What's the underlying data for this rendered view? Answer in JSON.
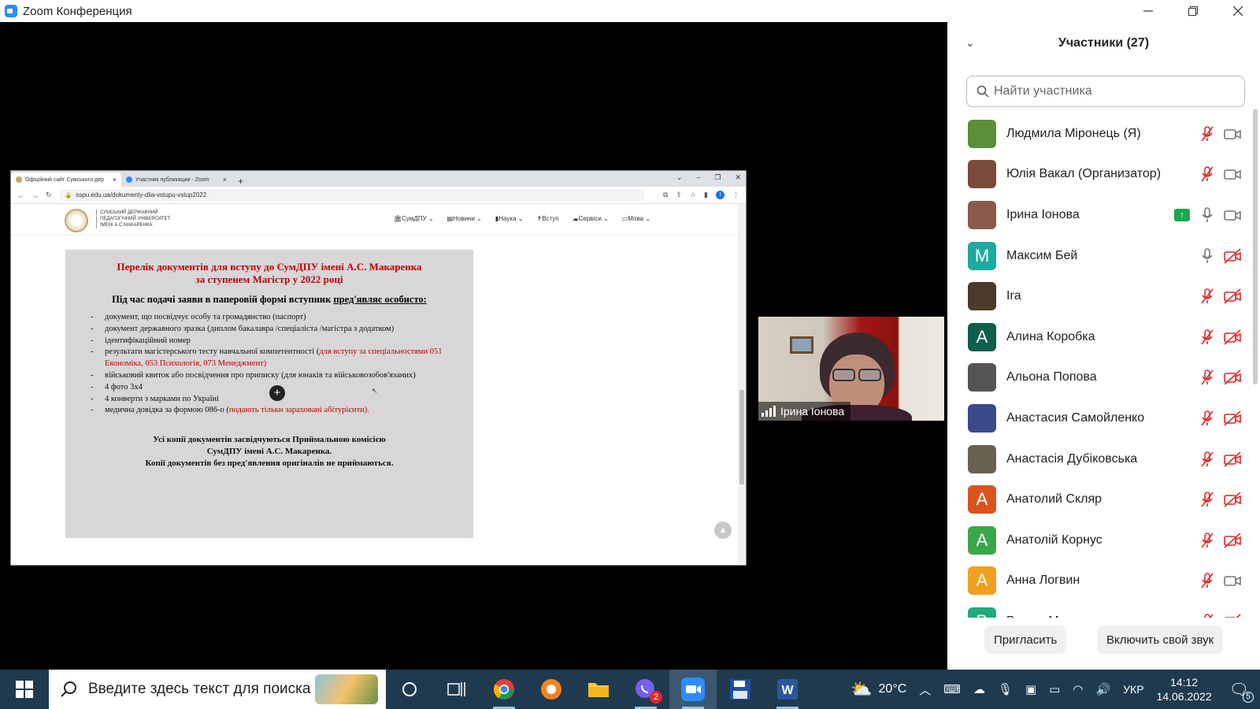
{
  "window": {
    "title": "Zoom Конференция"
  },
  "browser": {
    "tabs": [
      {
        "label": "Офіційний сайт Сумського дер"
      },
      {
        "label": "Участник публикации - Zoom"
      }
    ],
    "url": "sspu.edu.ua/dokumenty-dlia-vstupu-vstup2022",
    "site_name": "СУМСЬКИЙ ДЕРЖАВНИЙ ПЕДАГОГІЧНИЙ УНІВЕРСИТЕТ ІМЕНІ А.С.МАКАРЕНКА",
    "nav": [
      "СумДПУ",
      "Новини",
      "Наука",
      "Вступ",
      "Сервіси",
      "Мова"
    ],
    "doc": {
      "title_line1": "Перелік документів для вступу до СумДПУ імені А.С. Макаренка",
      "title_line2": "за ступенем Магістр у 2022 році",
      "subtitle_prefix": "Під час подачі заяви в паперовій формі вступник ",
      "subtitle_underlined": "пред'являє особисто:",
      "items": [
        {
          "text": "документ, що посвідчує особу та громадянство (паспорт)",
          "note": ""
        },
        {
          "text": "документ державного зразка (диплом бакалавра /спеціаліста /магістра з додатком)",
          "note": ""
        },
        {
          "text": "ідентифікаційний номер",
          "note": ""
        },
        {
          "text": "результати магістерського тесту навчальної компетентності (",
          "note": "для вступу за спеціальностями 051 Економіка, 053 Психологія, 073 Менеджмент",
          "suffix": ")"
        },
        {
          "text": "військовий квиток або посвідчення про приписку (для юнаків та військовозобов'язаних)",
          "note": ""
        },
        {
          "text": "4 фото 3х4",
          "note": ""
        },
        {
          "text": "4 конверти з марками по Україні",
          "note": ""
        },
        {
          "text": "медична довідка за формою 086-о (",
          "note": "подають тільки зараховані абітурієнти",
          "suffix": ")."
        }
      ],
      "footer_line1": "Усі копії документів засвідчуються Приймальною комісією",
      "footer_line2": "СумДПУ імені А.С. Макаренка.",
      "footer_line3": "Копії документів без пред'явлення оригіналів не приймаються."
    }
  },
  "video": {
    "name": "Ірина Іонова"
  },
  "panel": {
    "title": "Участники (27)",
    "search_placeholder": "Найти участника",
    "participants": [
      {
        "name": "Людмила Міронець (Я)",
        "avatar_letter": "",
        "avatar_color": "#5b8f3a",
        "mic": "muted",
        "video": "on",
        "hand": false
      },
      {
        "name": "Юлія Вакал (Организатор)",
        "avatar_letter": "",
        "avatar_color": "#7a4a3a",
        "mic": "muted",
        "video": "on",
        "hand": false
      },
      {
        "name": "Ірина Іонова",
        "avatar_letter": "",
        "avatar_color": "#8a5a4a",
        "mic": "on",
        "video": "on",
        "hand": true
      },
      {
        "name": "Максим Бей",
        "avatar_letter": "M",
        "avatar_color": "#1eaaa0",
        "mic": "on",
        "video": "off",
        "hand": false
      },
      {
        "name": "Ira",
        "avatar_letter": "",
        "avatar_color": "#4a3a2a",
        "mic": "muted",
        "video": "off",
        "hand": false
      },
      {
        "name": "Алина Коробка",
        "avatar_letter": "A",
        "avatar_color": "#0f5e4a",
        "mic": "muted",
        "video": "off",
        "hand": false
      },
      {
        "name": "Альона Попова",
        "avatar_letter": "",
        "avatar_color": "#555555",
        "mic": "muted",
        "video": "off",
        "hand": false
      },
      {
        "name": "Анастасия Самойленко",
        "avatar_letter": "",
        "avatar_color": "#3a4a8a",
        "mic": "muted",
        "video": "off",
        "hand": false
      },
      {
        "name": "Анастасія Дубіковська",
        "avatar_letter": "",
        "avatar_color": "#6a6050",
        "mic": "muted",
        "video": "off",
        "hand": false
      },
      {
        "name": "Анатолий  Скляр",
        "avatar_letter": "A",
        "avatar_color": "#d9541e",
        "mic": "muted",
        "video": "off",
        "hand": false
      },
      {
        "name": "Анатолій Корнус",
        "avatar_letter": "A",
        "avatar_color": "#3aa84a",
        "mic": "muted",
        "video": "off",
        "hand": false
      },
      {
        "name": "Анна Логвин",
        "avatar_letter": "A",
        "avatar_color": "#f0a01e",
        "mic": "muted",
        "video": "on",
        "hand": false
      },
      {
        "name": "Вадим М...",
        "avatar_letter": "B",
        "avatar_color": "#1eaa7a",
        "mic": "muted",
        "video": "off",
        "hand": false
      }
    ],
    "invite_label": "Пригласить",
    "unmute_label": "Включить свой звук"
  },
  "taskbar": {
    "search_placeholder": "Введите здесь текст для поиска",
    "temperature": "20°C",
    "language": "УКР",
    "time": "14:12",
    "date": "14.06.2022",
    "notification_count": "5",
    "viber_badge": "2"
  },
  "colors": {
    "zoom_blue": "#2D8CFF",
    "muted_red": "#e02828",
    "doc_red": "#c00000",
    "taskbar": "#1f3a4f"
  }
}
